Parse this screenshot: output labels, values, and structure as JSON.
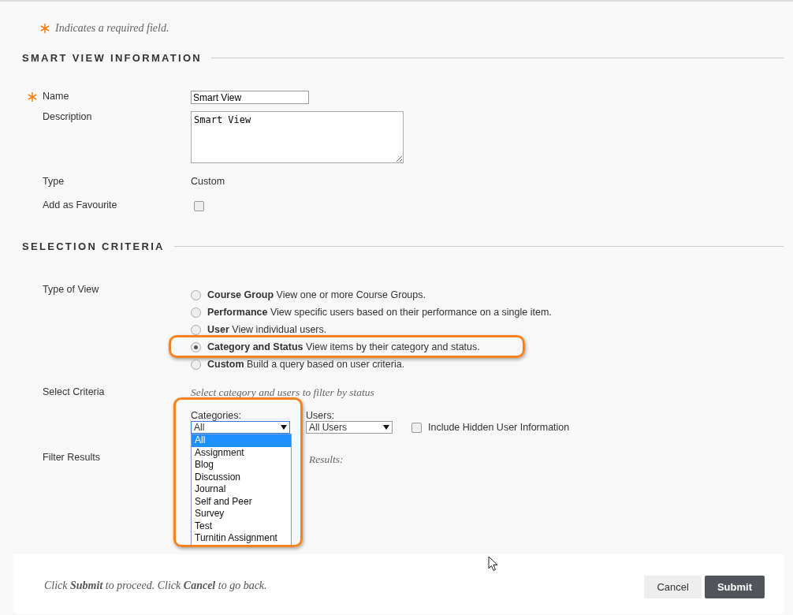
{
  "required_note": "Indicates a required field.",
  "sections": [
    {
      "title": "SMART VIEW INFORMATION"
    },
    {
      "title": "SELECTION CRITERIA"
    }
  ],
  "info": {
    "name": {
      "label": "Name",
      "required": true,
      "value": "Smart View"
    },
    "description": {
      "label": "Description",
      "value": "Smart View"
    },
    "type": {
      "label": "Type",
      "value": "Custom"
    },
    "favourite": {
      "label": "Add as Favourite",
      "checked": false
    }
  },
  "type_of_view": {
    "label": "Type of View",
    "options": [
      {
        "text": "**Course Group** View one or more Course Groups.",
        "selected": false,
        "highlighted": false
      },
      {
        "text": "**Performance** View specific users based on their performance on a single item.",
        "selected": false,
        "highlighted": false
      },
      {
        "text": "**User** View individual users.",
        "selected": false,
        "highlighted": false
      },
      {
        "text": "**Category and Status** View items by their category and status.",
        "selected": true,
        "highlighted": true
      },
      {
        "text": "**Custom** Build a query based on user criteria.",
        "selected": false,
        "highlighted": false
      }
    ]
  },
  "select_criteria": {
    "label": "Select Criteria",
    "hint": "Select category and users to filter by status",
    "categories": {
      "label": "Categories:",
      "value": "All",
      "expanded": true,
      "highlighted": true,
      "options": [
        {
          "label": "All",
          "selected": true
        },
        {
          "label": "Assignment",
          "selected": false
        },
        {
          "label": "Blog",
          "selected": false
        },
        {
          "label": "Discussion",
          "selected": false
        },
        {
          "label": "Journal",
          "selected": false
        },
        {
          "label": "Self and Peer",
          "selected": false
        },
        {
          "label": "Survey",
          "selected": false
        },
        {
          "label": "Test",
          "selected": false
        },
        {
          "label": "Turnitin Assignment",
          "selected": false
        }
      ]
    },
    "users": {
      "label": "Users:",
      "value": "All Users"
    },
    "hidden_info": {
      "label": "Include Hidden User Information",
      "checked": false
    }
  },
  "filter_results": {
    "label": "Filter Results",
    "hint": "Results:"
  },
  "footer": {
    "text": "Click **Submit** to proceed. Click **Cancel** to go back.",
    "buttons": [
      {
        "label": "Cancel",
        "kind": "secondary"
      },
      {
        "label": "Submit",
        "kind": "primary"
      }
    ]
  }
}
